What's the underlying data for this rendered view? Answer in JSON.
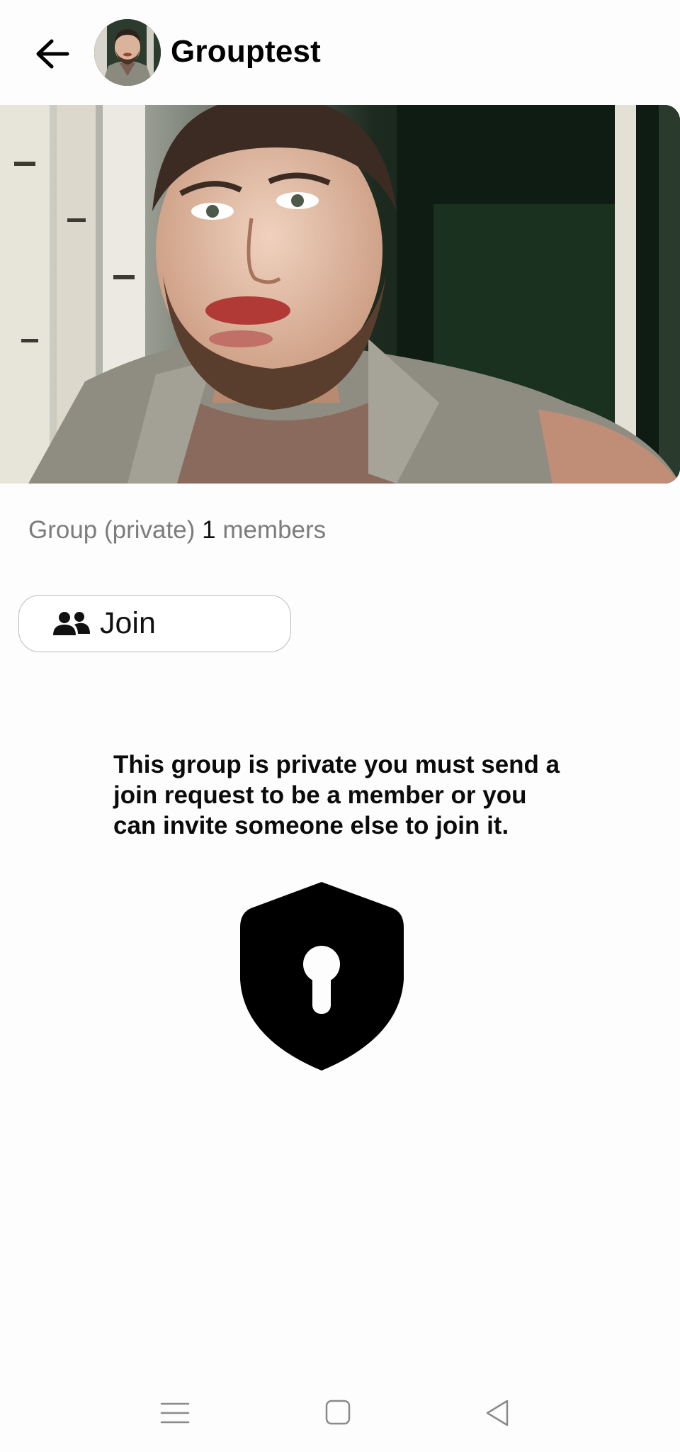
{
  "header": {
    "title": "Grouptest",
    "back_icon": "arrow-left-icon",
    "avatar_alt": "group-avatar"
  },
  "group_info": {
    "type_text": "Group (private)",
    "member_count": "1",
    "members_label": "members"
  },
  "join_button": {
    "label": "Join",
    "icon": "users-icon"
  },
  "notice": {
    "text": "This group is private you must send a join request to be a member or you can invite someone else to join it."
  },
  "lock_icon": "shield-lock-icon",
  "navbar": {
    "items": [
      "menu-icon",
      "home-square-icon",
      "back-triangle-icon"
    ]
  },
  "colors": {
    "background": "#fdfdfd",
    "muted_text": "#7c7c7c",
    "button_border": "#bdbdbd"
  }
}
